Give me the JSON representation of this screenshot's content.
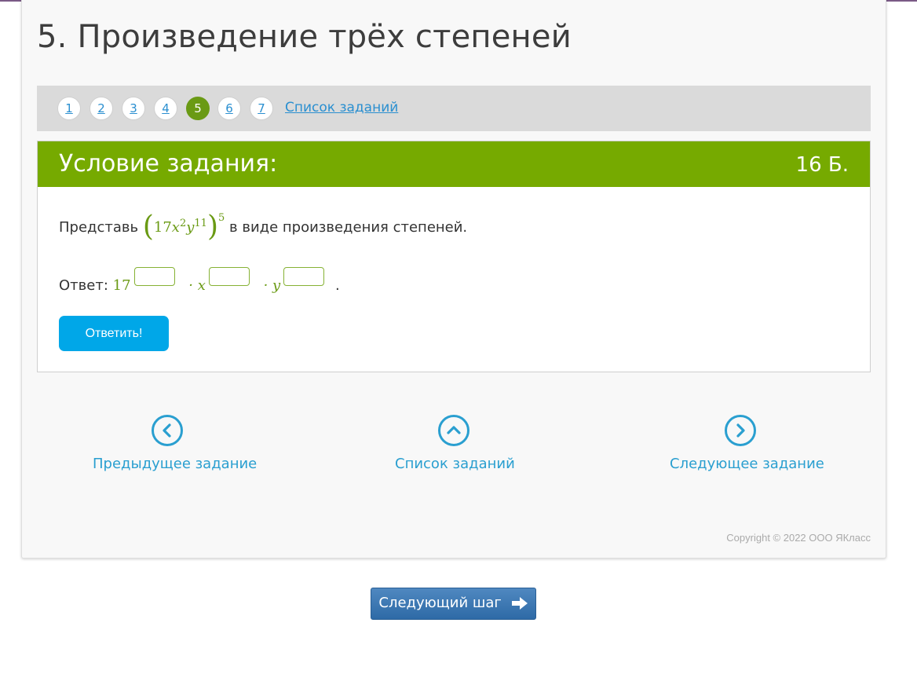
{
  "page": {
    "title": "5. Произведение трёх степеней"
  },
  "task_nav": {
    "numbers": [
      "1",
      "2",
      "3",
      "4",
      "5",
      "6",
      "7"
    ],
    "active": "5",
    "list_link": "Список заданий"
  },
  "condition": {
    "header": "Условие задания:",
    "points": "16 Б.",
    "prefix": "Представь",
    "expr": {
      "coef": "17",
      "var1": "x",
      "exp1": "2",
      "var2": "y",
      "exp2": "11",
      "outer_exp": "5"
    },
    "suffix": "в виде произведения степеней."
  },
  "answer": {
    "label": "Ответ:",
    "coef": "17",
    "dot_x": "· x",
    "dot_y": "· y",
    "end": ".",
    "input1": "",
    "input2": "",
    "input3": ""
  },
  "submit_label": "Ответить!",
  "bottom_nav": {
    "prev": "Предыдущее задание",
    "list": "Список заданий",
    "next": "Следующее задание"
  },
  "copyright": "Copyright © 2022 ООО ЯКласс",
  "next_step_label": "Следующий шаг",
  "colors": {
    "accent_green": "#76aa00",
    "link_blue": "#2a9fd0",
    "button_blue": "#00a7e8"
  }
}
